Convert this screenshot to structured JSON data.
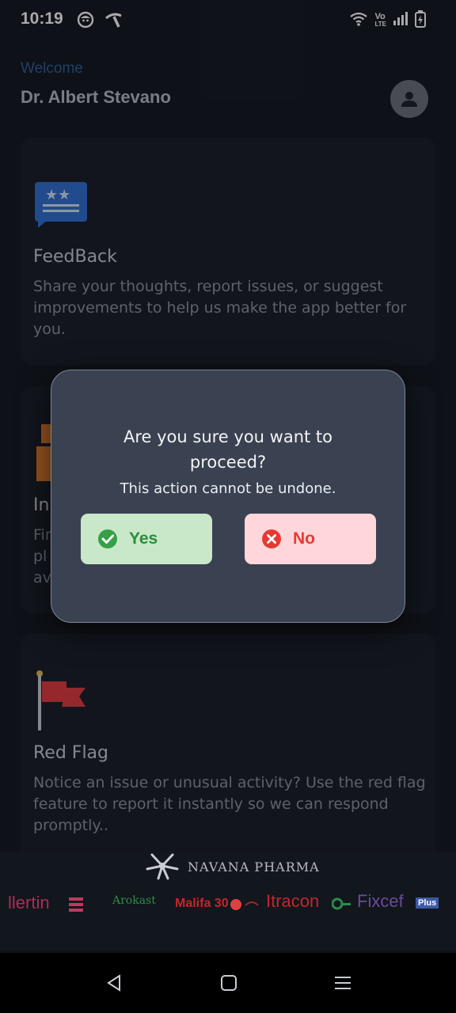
{
  "status_bar": {
    "time": "10:19",
    "left_icons": [
      "app-face-icon",
      "network-logo-icon"
    ],
    "right_icons": [
      "wifi-icon",
      "volte-icon",
      "signal-icon",
      "battery-charging-icon"
    ],
    "volte_top": "Vo",
    "volte_bottom": "LTE"
  },
  "header": {
    "welcome": "Welcome",
    "doctor_name": "Dr. Albert Stevano",
    "avatar_icon": "user-avatar-icon"
  },
  "cards": [
    {
      "icon": "feedback-stars-icon",
      "title": "FeedBack",
      "description": "Share your thoughts, report issues, or suggest improvements to help us make the app better for you."
    },
    {
      "icon": "info-box-icon",
      "title": "In",
      "description_lines": [
        "Fin",
        "pl",
        "av"
      ]
    },
    {
      "icon": "red-flag-icon",
      "title": "Red Flag",
      "description": "Notice an issue or unusual activity? Use the red flag feature to report it instantly so we can respond promptly.."
    }
  ],
  "dialog": {
    "question": "Are you sure you want to proceed?",
    "subtitle": "This action cannot be undone.",
    "yes_label": "Yes",
    "no_label": "No"
  },
  "brands": {
    "company": "NAVANA PHARMA",
    "products": [
      "llertin",
      "Arokast",
      "Malifa 30",
      "Itracon",
      "Fixcef",
      "Plus"
    ]
  },
  "nav": {
    "back": "back-triangle-icon",
    "home": "home-square-icon",
    "menu": "menu-lines-icon"
  },
  "colors": {
    "background": "#12161d",
    "card": "#181d26",
    "yes_bg": "#c8e8c9",
    "yes_fg": "#2e8b3a",
    "no_bg": "#ffd6da",
    "no_fg": "#e53935",
    "welcome": "#2f5f9a"
  }
}
